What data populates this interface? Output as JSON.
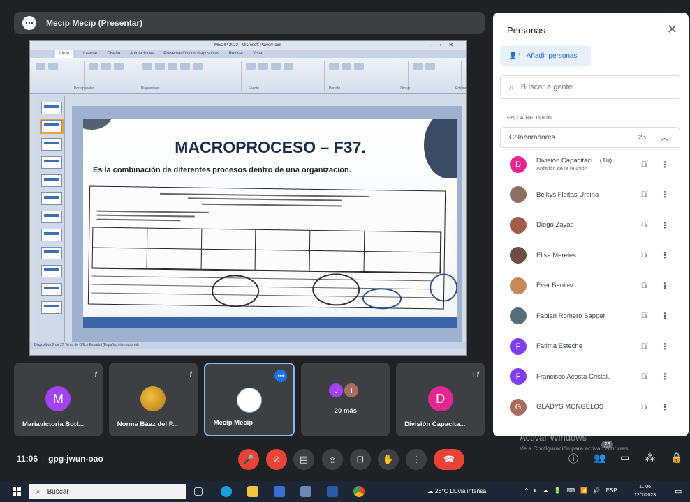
{
  "presenter": {
    "name": "Mecip Mecip (Presentar)"
  },
  "ppt": {
    "window_title": "MECIP 2023 - Microsoft PowerPoint",
    "tabs": [
      "Inicio",
      "Insertar",
      "Diseño",
      "Animaciones",
      "Presentación con diapositivas",
      "Revisar",
      "Vista"
    ],
    "groups": [
      "Portapapeles",
      "Diapositivas",
      "Fuente",
      "Párrafo",
      "Dibujo",
      "Edición"
    ],
    "status": "Diapositiva 2 de 27     Tema de Office     Español (España, internacional)"
  },
  "slide": {
    "title": "MACROPROCESO – F37.",
    "subtitle": "Es la combinación de diferentes procesos dentro de una organización."
  },
  "tiles": [
    {
      "name": "Mariavictoria Bott...",
      "initial": "M",
      "color": "#a142f4"
    },
    {
      "name": "Norma Báez del P...",
      "initial": "",
      "color": "#d2a23a"
    },
    {
      "name": "Mecip Mecip",
      "initial": "",
      "color": "#ffffff"
    },
    {
      "more": "20 más",
      "mini1": "J",
      "mini2": "T"
    },
    {
      "name": "División Capacita...",
      "initial": "D",
      "color": "#e52592"
    }
  ],
  "bottom": {
    "time": "11:06",
    "code": "gpg-jwun-oao",
    "people_badge": "26"
  },
  "people": {
    "title": "Personas",
    "add_label": "Añadir personas",
    "search_placeholder": "Buscar a gente",
    "section": "EN LA REUNIÓN",
    "group_label": "Colaboradores",
    "group_count": "25",
    "list": [
      {
        "name": "División Capacitaci...  (Tú)",
        "sub": "Anfitrión de la reunión",
        "initial": "D",
        "color": "#e52592"
      },
      {
        "name": "Belkys Fleitas Urbina",
        "initial": "",
        "color": "#8d6e63"
      },
      {
        "name": "Diego Zayas",
        "initial": "",
        "color": "#a15c4a"
      },
      {
        "name": "Elisa Mereles",
        "initial": "",
        "color": "#6d4c41"
      },
      {
        "name": "Ever Benitez",
        "initial": "",
        "color": "#c68a5a"
      },
      {
        "name": "Fabian Romero Sapper",
        "initial": "",
        "color": "#546e7a"
      },
      {
        "name": "Fatima Esteche",
        "initial": "F",
        "color": "#7e3ff2"
      },
      {
        "name": "Francisco Acosta Cristal...",
        "initial": "F",
        "color": "#7e3ff2"
      },
      {
        "name": "GLADYS MONGELOS",
        "initial": "G",
        "color": "#a86b5d"
      }
    ]
  },
  "watermark": {
    "line1": "Activar Windows",
    "line2": "Ve a Configuración para activar Windows."
  },
  "taskbar": {
    "search": "Buscar",
    "weather": "26°C  Lluvia intensa",
    "lang": "ESP",
    "time": "11:06",
    "date": "12/7/2023"
  },
  "colors": {
    "hang": "#ea4335",
    "accent": "#1a73e8",
    "meet_bg": "#202124"
  }
}
